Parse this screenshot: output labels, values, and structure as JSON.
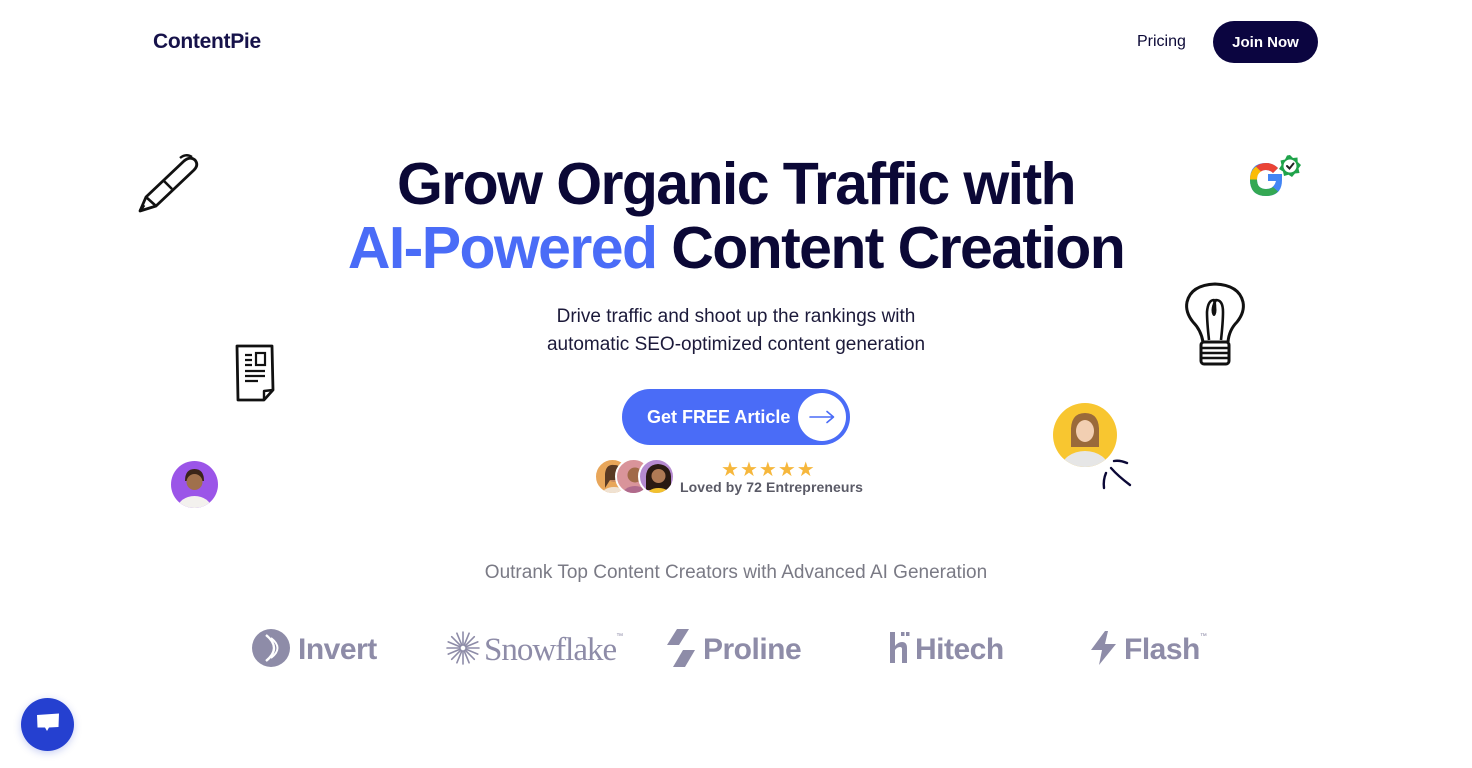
{
  "nav": {
    "logo": "ContentPie",
    "links": [
      {
        "label": "Pricing"
      }
    ],
    "cta_label": "Join Now"
  },
  "hero": {
    "title_line1": "Grow Organic Traffic with",
    "title_line2_accent": "AI-Powered",
    "title_line2_rest": "Content Creation",
    "subtitle_line1": "Drive traffic and shoot up the rankings with",
    "subtitle_line2": "automatic SEO-optimized content generation",
    "cta_label": "Get FREE Article",
    "cta_icon": "arrow-right-icon",
    "rating_stars": 5,
    "rating_max": 5,
    "social_proof_text": "Loved by 72 Entrepreneurs"
  },
  "decorations": [
    {
      "icon": "pen-icon"
    },
    {
      "icon": "document-icon"
    },
    {
      "icon": "google-verified-icon"
    },
    {
      "icon": "lightbulb-icon"
    },
    {
      "icon": "avatar-purple"
    },
    {
      "icon": "avatar-yellow"
    }
  ],
  "trusted": {
    "heading": "Outrank Top Content Creators with Advanced AI Generation",
    "brands": [
      {
        "name": "Invert",
        "icon": "invert-logo-icon"
      },
      {
        "name": "Snowflake",
        "icon": "snowflake-burst-icon",
        "tm": "™"
      },
      {
        "name": "Proline",
        "icon": "proline-slashes-icon"
      },
      {
        "name": "Hitech",
        "icon": "hitech-h-icon"
      },
      {
        "name": "Flash",
        "icon": "lightning-bolt-icon",
        "tm": "™"
      }
    ]
  },
  "colors": {
    "primary_dark": "#0b0540",
    "accent_blue": "#4a6cf7",
    "chat_blue": "#2540d0",
    "star": "#f6b73c",
    "brand_gray": "#8e8ca8"
  },
  "chat": {
    "icon": "chat-bubble-icon"
  }
}
